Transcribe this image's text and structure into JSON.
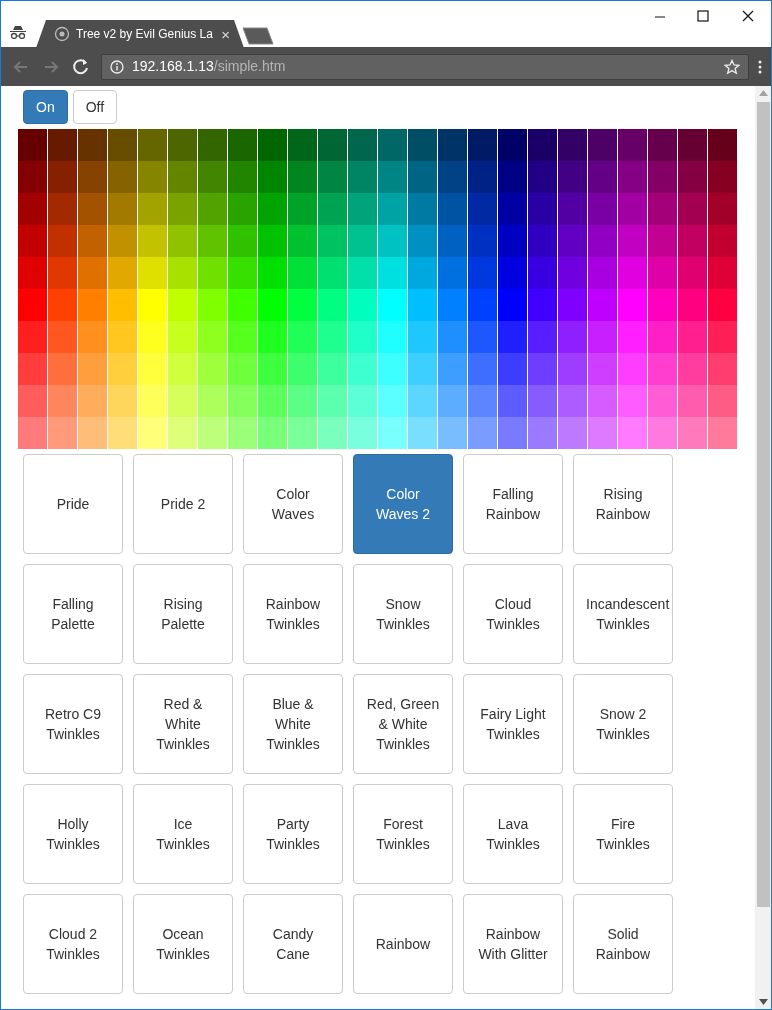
{
  "tab": {
    "title": "Tree v2 by Evil Genius La",
    "close": "×"
  },
  "address_bar": {
    "host": "192.168.1.13",
    "path": "/simple.htm"
  },
  "power_buttons": [
    {
      "label": "On",
      "selected": true
    },
    {
      "label": "Off",
      "selected": false
    }
  ],
  "color_grid": [
    [
      {
        "color": "#660000"
      },
      {
        "color": "#661a00"
      },
      {
        "color": "#663300"
      },
      {
        "color": "#664d00"
      },
      {
        "color": "#666600"
      },
      {
        "color": "#4d6600"
      },
      {
        "color": "#336600"
      },
      {
        "color": "#1a6600"
      },
      {
        "color": "#006600"
      },
      {
        "color": "#00661a"
      },
      {
        "color": "#006633"
      },
      {
        "color": "#00664d"
      },
      {
        "color": "#006666"
      },
      {
        "color": "#004d66"
      },
      {
        "color": "#003366"
      },
      {
        "color": "#001a66"
      },
      {
        "color": "#000066"
      },
      {
        "color": "#1a0066"
      },
      {
        "color": "#330066"
      },
      {
        "color": "#4d0066"
      },
      {
        "color": "#660066"
      },
      {
        "color": "#66004d"
      },
      {
        "color": "#660033"
      },
      {
        "color": "#66001a"
      }
    ],
    [
      {
        "color": "#850000"
      },
      {
        "color": "#852100"
      },
      {
        "color": "#854200"
      },
      {
        "color": "#856400"
      },
      {
        "color": "#858500"
      },
      {
        "color": "#648500"
      },
      {
        "color": "#428500"
      },
      {
        "color": "#218500"
      },
      {
        "color": "#008500"
      },
      {
        "color": "#008521"
      },
      {
        "color": "#008542"
      },
      {
        "color": "#008564"
      },
      {
        "color": "#008585"
      },
      {
        "color": "#006485"
      },
      {
        "color": "#004285"
      },
      {
        "color": "#002185"
      },
      {
        "color": "#000085"
      },
      {
        "color": "#210085"
      },
      {
        "color": "#420085"
      },
      {
        "color": "#640085"
      },
      {
        "color": "#850085"
      },
      {
        "color": "#850064"
      },
      {
        "color": "#850042"
      },
      {
        "color": "#850021"
      }
    ],
    [
      {
        "color": "#a30000"
      },
      {
        "color": "#a32900"
      },
      {
        "color": "#a35200"
      },
      {
        "color": "#a37a00"
      },
      {
        "color": "#a3a300"
      },
      {
        "color": "#7aa300"
      },
      {
        "color": "#52a300"
      },
      {
        "color": "#29a300"
      },
      {
        "color": "#00a300"
      },
      {
        "color": "#00a329"
      },
      {
        "color": "#00a352"
      },
      {
        "color": "#00a37a"
      },
      {
        "color": "#00a3a3"
      },
      {
        "color": "#007aa3"
      },
      {
        "color": "#0052a3"
      },
      {
        "color": "#0029a3"
      },
      {
        "color": "#0000a3"
      },
      {
        "color": "#2900a3"
      },
      {
        "color": "#5200a3"
      },
      {
        "color": "#7a00a3"
      },
      {
        "color": "#a300a3"
      },
      {
        "color": "#a3007a"
      },
      {
        "color": "#a30052"
      },
      {
        "color": "#a30029"
      }
    ],
    [
      {
        "color": "#c20000"
      },
      {
        "color": "#c23000"
      },
      {
        "color": "#c26100"
      },
      {
        "color": "#c29100"
      },
      {
        "color": "#c2c200"
      },
      {
        "color": "#91c200"
      },
      {
        "color": "#61c200"
      },
      {
        "color": "#30c200"
      },
      {
        "color": "#00c200"
      },
      {
        "color": "#00c230"
      },
      {
        "color": "#00c261"
      },
      {
        "color": "#00c291"
      },
      {
        "color": "#00c2c2"
      },
      {
        "color": "#0091c2"
      },
      {
        "color": "#0061c2"
      },
      {
        "color": "#0030c2"
      },
      {
        "color": "#0000c2"
      },
      {
        "color": "#3000c2"
      },
      {
        "color": "#6100c2"
      },
      {
        "color": "#9100c2"
      },
      {
        "color": "#c200c2"
      },
      {
        "color": "#c20091"
      },
      {
        "color": "#c20061"
      },
      {
        "color": "#c20030"
      }
    ],
    [
      {
        "color": "#e00000"
      },
      {
        "color": "#e03800"
      },
      {
        "color": "#e07000"
      },
      {
        "color": "#e0a800"
      },
      {
        "color": "#e0e000"
      },
      {
        "color": "#a8e000"
      },
      {
        "color": "#70e000"
      },
      {
        "color": "#38e000"
      },
      {
        "color": "#00e000"
      },
      {
        "color": "#00e038"
      },
      {
        "color": "#00e070"
      },
      {
        "color": "#00e0a8"
      },
      {
        "color": "#00e0e0"
      },
      {
        "color": "#00a8e0"
      },
      {
        "color": "#0070e0"
      },
      {
        "color": "#0038e0"
      },
      {
        "color": "#0000e0"
      },
      {
        "color": "#3800e0"
      },
      {
        "color": "#7000e0"
      },
      {
        "color": "#a800e0"
      },
      {
        "color": "#e000e0"
      },
      {
        "color": "#e000a8"
      },
      {
        "color": "#e00070"
      },
      {
        "color": "#e00038"
      }
    ],
    [
      {
        "color": "#ff0000"
      },
      {
        "color": "#ff4000"
      },
      {
        "color": "#ff8000"
      },
      {
        "color": "#ffbf00"
      },
      {
        "color": "#ffff00"
      },
      {
        "color": "#bfff00"
      },
      {
        "color": "#80ff00"
      },
      {
        "color": "#40ff00"
      },
      {
        "color": "#00ff00"
      },
      {
        "color": "#00ff40"
      },
      {
        "color": "#00ff80"
      },
      {
        "color": "#00ffbf"
      },
      {
        "color": "#00ffff"
      },
      {
        "color": "#00bfff"
      },
      {
        "color": "#0080ff"
      },
      {
        "color": "#0040ff"
      },
      {
        "color": "#0000ff"
      },
      {
        "color": "#4000ff"
      },
      {
        "color": "#8000ff"
      },
      {
        "color": "#bf00ff"
      },
      {
        "color": "#ff00ff"
      },
      {
        "color": "#ff00bf"
      },
      {
        "color": "#ff0080"
      },
      {
        "color": "#ff0040"
      }
    ],
    [
      {
        "color": "#ff1f1f"
      },
      {
        "color": "#ff571f"
      },
      {
        "color": "#ff8f1f"
      },
      {
        "color": "#ffc71f"
      },
      {
        "color": "#ffff1f"
      },
      {
        "color": "#c7ff1f"
      },
      {
        "color": "#8fff1f"
      },
      {
        "color": "#57ff1f"
      },
      {
        "color": "#1fff1f"
      },
      {
        "color": "#1fff57"
      },
      {
        "color": "#1fff8f"
      },
      {
        "color": "#1fffc7"
      },
      {
        "color": "#1fffff"
      },
      {
        "color": "#1fc7ff"
      },
      {
        "color": "#1f8fff"
      },
      {
        "color": "#1f57ff"
      },
      {
        "color": "#1f1fff"
      },
      {
        "color": "#571fff"
      },
      {
        "color": "#8f1fff"
      },
      {
        "color": "#c71fff"
      },
      {
        "color": "#ff1fff"
      },
      {
        "color": "#ff1fc7"
      },
      {
        "color": "#ff1f8f"
      },
      {
        "color": "#ff1f57"
      }
    ],
    [
      {
        "color": "#ff3d3d"
      },
      {
        "color": "#ff6e3d"
      },
      {
        "color": "#ff9e3d"
      },
      {
        "color": "#ffcf3d"
      },
      {
        "color": "#ffff3d"
      },
      {
        "color": "#cfff3d"
      },
      {
        "color": "#9eff3d"
      },
      {
        "color": "#6eff3d"
      },
      {
        "color": "#3dff3d"
      },
      {
        "color": "#3dff6e"
      },
      {
        "color": "#3dff9e"
      },
      {
        "color": "#3dffcf"
      },
      {
        "color": "#3dffff"
      },
      {
        "color": "#3dcfff"
      },
      {
        "color": "#3d9eff"
      },
      {
        "color": "#3d6eff"
      },
      {
        "color": "#3d3dff"
      },
      {
        "color": "#6e3dff"
      },
      {
        "color": "#9e3dff"
      },
      {
        "color": "#cf3dff"
      },
      {
        "color": "#ff3dff"
      },
      {
        "color": "#ff3dcf"
      },
      {
        "color": "#ff3d9e"
      },
      {
        "color": "#ff3d6e"
      }
    ],
    [
      {
        "color": "#ff5c5c"
      },
      {
        "color": "#ff855c"
      },
      {
        "color": "#ffad5c"
      },
      {
        "color": "#ffd65c"
      },
      {
        "color": "#ffff5c"
      },
      {
        "color": "#d6ff5c"
      },
      {
        "color": "#adff5c"
      },
      {
        "color": "#85ff5c"
      },
      {
        "color": "#5cff5c"
      },
      {
        "color": "#5cff85"
      },
      {
        "color": "#5cffad"
      },
      {
        "color": "#5cffd6"
      },
      {
        "color": "#5cffff"
      },
      {
        "color": "#5cd6ff"
      },
      {
        "color": "#5cadff"
      },
      {
        "color": "#5c85ff"
      },
      {
        "color": "#5c5cff"
      },
      {
        "color": "#855cff"
      },
      {
        "color": "#ad5cff"
      },
      {
        "color": "#d65cff"
      },
      {
        "color": "#ff5cff"
      },
      {
        "color": "#ff5cd6"
      },
      {
        "color": "#ff5cad"
      },
      {
        "color": "#ff5c85"
      }
    ],
    [
      {
        "color": "#ff7a7a"
      },
      {
        "color": "#ff9b7a"
      },
      {
        "color": "#ffbd7a"
      },
      {
        "color": "#ffde7a"
      },
      {
        "color": "#ffff7a"
      },
      {
        "color": "#deff7a"
      },
      {
        "color": "#bdff7a"
      },
      {
        "color": "#9bff7a"
      },
      {
        "color": "#7aff7a"
      },
      {
        "color": "#7aff9b"
      },
      {
        "color": "#7affbd"
      },
      {
        "color": "#7affde"
      },
      {
        "color": "#7affff"
      },
      {
        "color": "#7adeff"
      },
      {
        "color": "#7abdff"
      },
      {
        "color": "#7a9bff"
      },
      {
        "color": "#7a7aff"
      },
      {
        "color": "#9b7aff"
      },
      {
        "color": "#bd7aff"
      },
      {
        "color": "#de7aff"
      },
      {
        "color": "#ff7aff"
      },
      {
        "color": "#ff7ade"
      },
      {
        "color": "#ff7abd"
      },
      {
        "color": "#ff7a9b"
      }
    ]
  ],
  "patterns": [
    {
      "label": "Pride",
      "selected": false
    },
    {
      "label": "Pride 2",
      "selected": false
    },
    {
      "label": "Color Waves",
      "selected": false
    },
    {
      "label": "Color Waves 2",
      "selected": true
    },
    {
      "label": "Falling Rainbow",
      "selected": false
    },
    {
      "label": "Rising Rainbow",
      "selected": false
    },
    {
      "label": "Falling Palette",
      "selected": false
    },
    {
      "label": "Rising Palette",
      "selected": false
    },
    {
      "label": "Rainbow Twinkles",
      "selected": false
    },
    {
      "label": "Snow Twinkles",
      "selected": false
    },
    {
      "label": "Cloud Twinkles",
      "selected": false
    },
    {
      "label": "Incandescent Twinkles",
      "selected": false
    },
    {
      "label": "Retro C9 Twinkles",
      "selected": false
    },
    {
      "label": "Red & White Twinkles",
      "selected": false
    },
    {
      "label": "Blue & White Twinkles",
      "selected": false
    },
    {
      "label": "Red, Green & White Twinkles",
      "selected": false
    },
    {
      "label": "Fairy Light Twinkles",
      "selected": false
    },
    {
      "label": "Snow 2 Twinkles",
      "selected": false
    },
    {
      "label": "Holly Twinkles",
      "selected": false
    },
    {
      "label": "Ice Twinkles",
      "selected": false
    },
    {
      "label": "Party Twinkles",
      "selected": false
    },
    {
      "label": "Forest Twinkles",
      "selected": false
    },
    {
      "label": "Lava Twinkles",
      "selected": false
    },
    {
      "label": "Fire Twinkles",
      "selected": false
    },
    {
      "label": "Cloud 2 Twinkles",
      "selected": false
    },
    {
      "label": "Ocean Twinkles",
      "selected": false
    },
    {
      "label": "Candy Cane",
      "selected": false
    },
    {
      "label": "Rainbow",
      "selected": false
    },
    {
      "label": "Rainbow With Glitter",
      "selected": false
    },
    {
      "label": "Solid Rainbow",
      "selected": false
    }
  ]
}
